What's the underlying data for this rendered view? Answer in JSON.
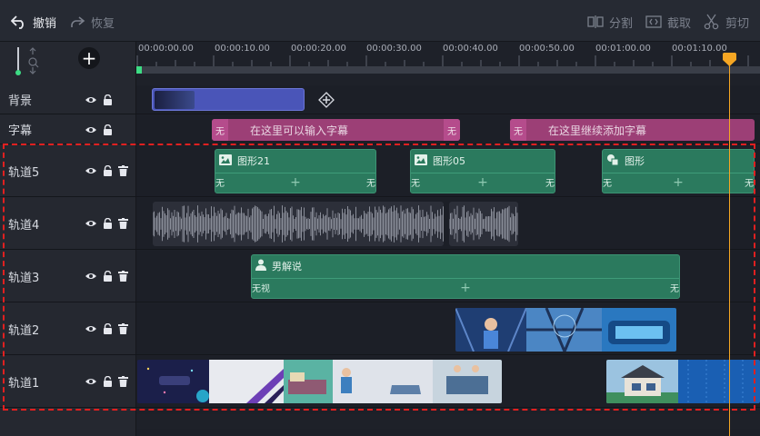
{
  "toolbar": {
    "undo_label": "撤销",
    "redo_label": "恢复",
    "split_label": "分割",
    "crop_label": "截取",
    "cut_label": "剪切"
  },
  "ruler": {
    "ticks": [
      "00:00:00.00",
      "00:00:10.00",
      "00:00:20.00",
      "00:00:30.00",
      "00:00:40.00",
      "00:00:50.00",
      "00:01:00.00",
      "00:01:10.00"
    ]
  },
  "tracks": {
    "background": {
      "label": "背景"
    },
    "subtitle": {
      "label": "字幕",
      "clip1_text": "在这里可以输入字幕",
      "clip2_text": "在这里继续添加字幕",
      "edge_mark": "无"
    },
    "track5": {
      "label": "轨道5",
      "clips": [
        "图形21",
        "图形05",
        "图形"
      ],
      "edge_mark": "无"
    },
    "track4": {
      "label": "轨道4"
    },
    "track3": {
      "label": "轨道3",
      "clip_title": "男解说",
      "edge_left": "无视",
      "edge_right": "无"
    },
    "track2": {
      "label": "轨道2"
    },
    "track1": {
      "label": "轨道1"
    }
  },
  "colors": {
    "accent_playhead": "#f5a623",
    "subtitle_clip": "#9c3f76",
    "graphic_clip": "#2b7a5e",
    "background_clip": "#4a55b8",
    "selection_border": "#e02020"
  }
}
